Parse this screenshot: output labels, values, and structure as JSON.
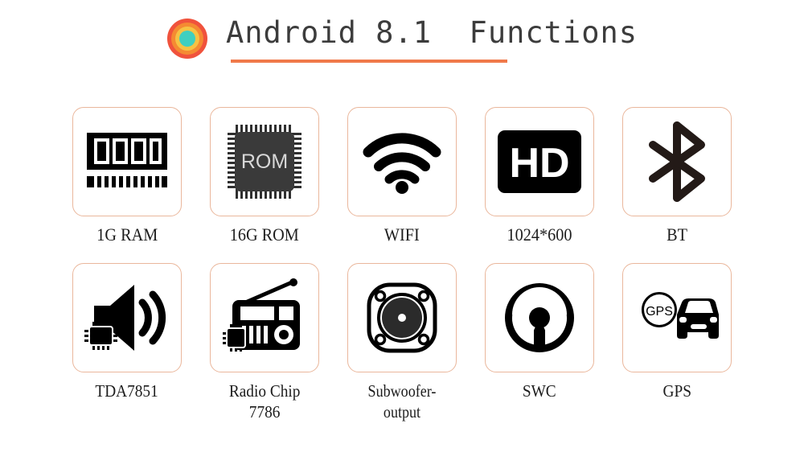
{
  "header": {
    "logo_icon": "concentric-circles-logo",
    "title": "Android 8.1  Functions",
    "accent_color": "#f0794a",
    "title_color": "#3c3c3c"
  },
  "theme": {
    "background": "#ffffff",
    "card_border_color": "#eab79c",
    "icon_color": "#000000",
    "logo_outer_color": "#f0523c",
    "logo_mid_color": "#f58a32",
    "logo_inner_ring_color": "#f6c244",
    "logo_center_color": "#3fcfc0"
  },
  "features": [
    {
      "row": 1,
      "icon": "ram-module-icon",
      "label": "1G RAM"
    },
    {
      "row": 1,
      "icon": "rom-chip-icon",
      "icon_text": "ROM",
      "label": "16G ROM"
    },
    {
      "row": 1,
      "icon": "wifi-icon",
      "label": "WIFI"
    },
    {
      "row": 1,
      "icon": "hd-screen-icon",
      "icon_text": "HD",
      "label": "1024*600"
    },
    {
      "row": 1,
      "icon": "bluetooth-icon",
      "label": "BT"
    },
    {
      "row": 2,
      "icon": "amplifier-speaker-chip-icon",
      "label": "TDA7851"
    },
    {
      "row": 2,
      "icon": "radio-chip-icon",
      "label": "Radio Chip\n7786"
    },
    {
      "row": 2,
      "icon": "subwoofer-speaker-icon",
      "label": "Subwoofer-output"
    },
    {
      "row": 2,
      "icon": "steering-wheel-icon",
      "label": "SWC"
    },
    {
      "row": 2,
      "icon": "gps-car-pin-icon",
      "icon_text": "GPS",
      "label": "GPS"
    }
  ]
}
